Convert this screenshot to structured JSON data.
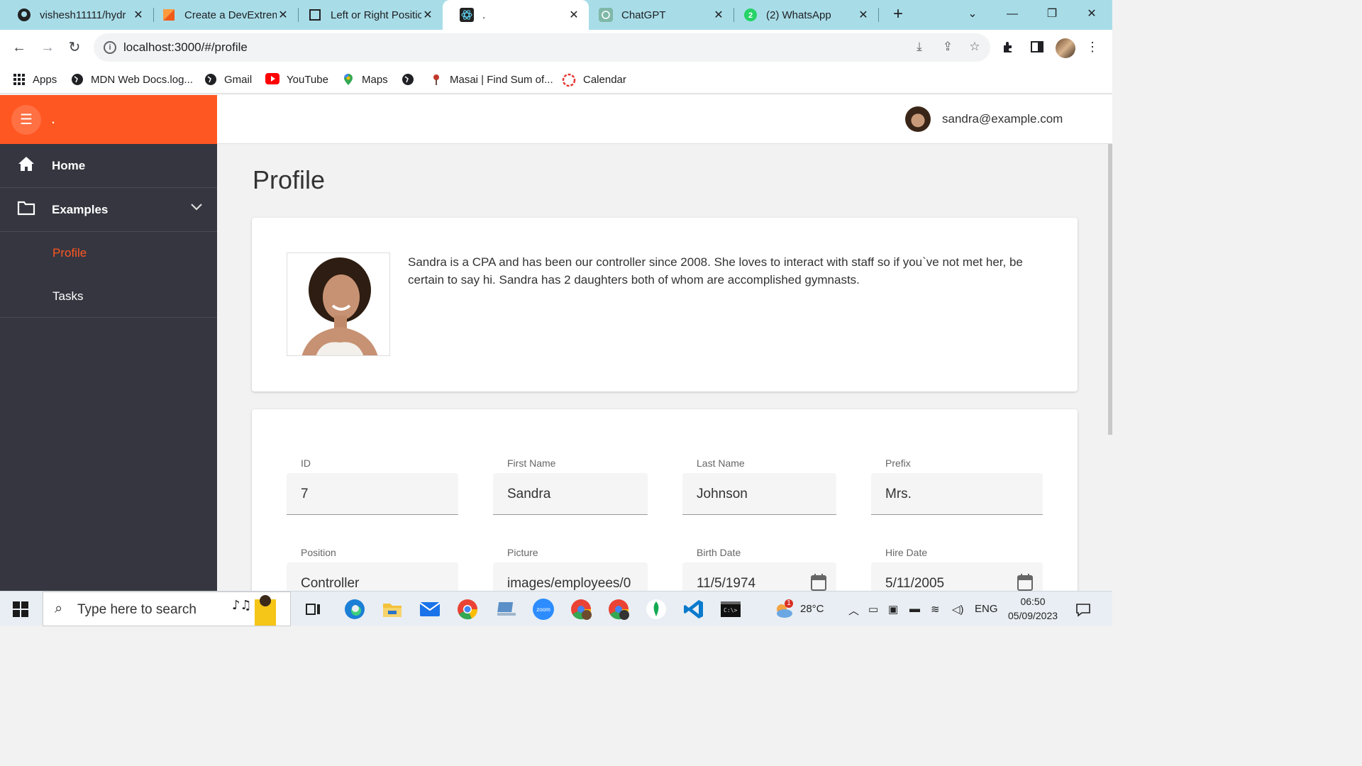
{
  "browser": {
    "tabs": [
      {
        "label": "vishesh11111/hydr",
        "icon": "github-icon"
      },
      {
        "label": "Create a DevExtrem",
        "icon": "devextreme-icon"
      },
      {
        "label": "Left or Right Positic",
        "icon": "page-icon"
      },
      {
        "label": ".",
        "icon": "react-icon",
        "active": true
      },
      {
        "label": "ChatGPT",
        "icon": "chatgpt-icon"
      },
      {
        "label": "(2) WhatsApp",
        "icon": "whatsapp-icon"
      }
    ],
    "url": "localhost:3000/#/profile",
    "bookmarks": [
      "Apps",
      "MDN Web Docs.log...",
      "Gmail",
      "YouTube",
      "Maps",
      "",
      "Masai | Find Sum of...",
      "Calendar"
    ]
  },
  "app": {
    "title": ".",
    "user_email": "sandra@example.com",
    "accent": "#ff5722",
    "sidebar": {
      "home": "Home",
      "examples": "Examples",
      "profile": "Profile",
      "tasks": "Tasks"
    },
    "page_title": "Profile",
    "bio": "Sandra is a CPA and has been our controller since 2008. She loves to interact with staff so if you`ve not met her, be certain to say hi. Sandra has 2 daughters both of whom are accomplished gymnasts.",
    "fields": {
      "id": {
        "label": "ID",
        "value": "7"
      },
      "first_name": {
        "label": "First Name",
        "value": "Sandra"
      },
      "last_name": {
        "label": "Last Name",
        "value": "Johnson"
      },
      "prefix": {
        "label": "Prefix",
        "value": "Mrs."
      },
      "position": {
        "label": "Position",
        "value": "Controller"
      },
      "picture": {
        "label": "Picture",
        "value": "images/employees/0"
      },
      "birth_date": {
        "label": "Birth Date",
        "value": "11/5/1974"
      },
      "hire_date": {
        "label": "Hire Date",
        "value": "5/11/2005"
      }
    }
  },
  "taskbar": {
    "search_placeholder": "Type here to search",
    "weather": "28°C",
    "weather_badge": "1",
    "language": "ENG",
    "time": "06:50",
    "date": "05/09/2023"
  }
}
